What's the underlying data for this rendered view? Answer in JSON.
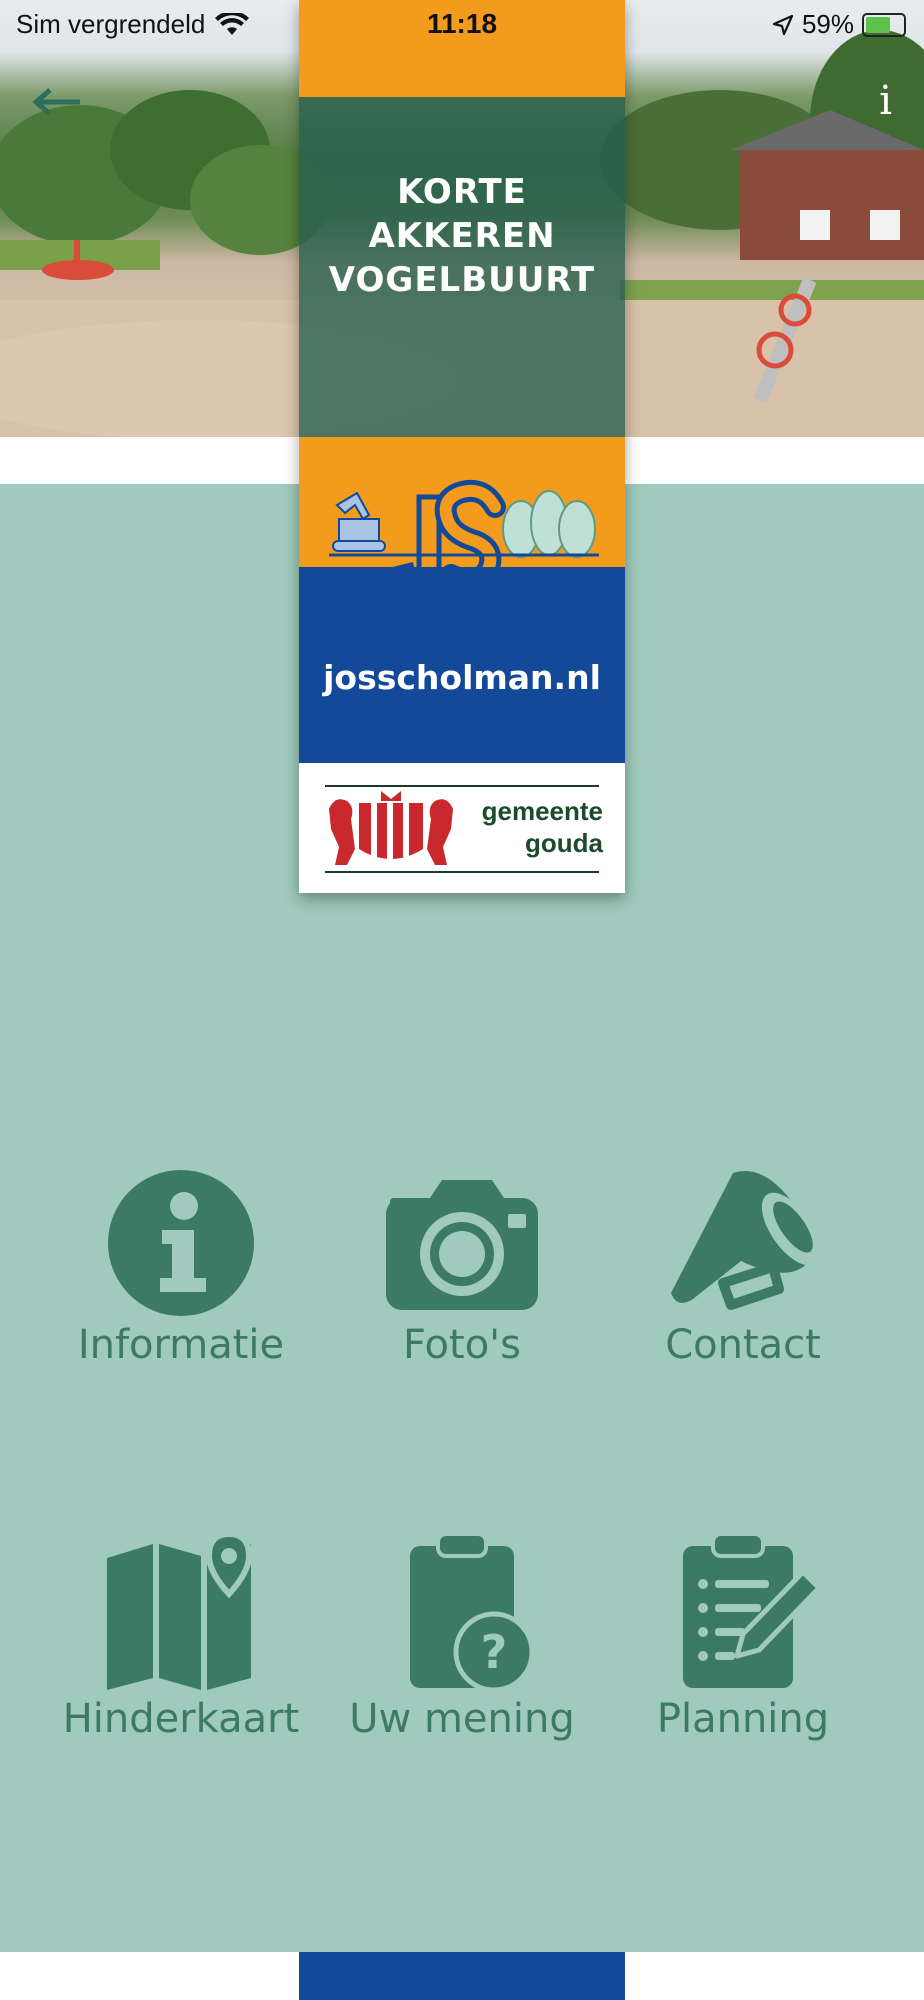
{
  "status_bar": {
    "carrier": "Sim vergrendeld",
    "time": "11:18",
    "battery": "59%",
    "battery_level": 0.59
  },
  "navigation": {
    "back_icon": "arrow-left-icon",
    "info_label": "i"
  },
  "banner": {
    "title_lines": [
      "KORTE",
      "AKKEREN",
      "VOGELBUURT"
    ],
    "website": "josscholman.nl",
    "municipality_lines": [
      "gemeente",
      "gouda"
    ],
    "colors": {
      "orange": "#f39b1d",
      "blue": "#134999",
      "green_overlay": "#245e4c"
    }
  },
  "menu": {
    "items": [
      {
        "label": "Informatie",
        "icon": "info-icon"
      },
      {
        "label": "Foto's",
        "icon": "camera-icon"
      },
      {
        "label": "Contact",
        "icon": "megaphone-icon"
      },
      {
        "label": "Hinderkaart",
        "icon": "map-pin-icon"
      },
      {
        "label": "Uw mening",
        "icon": "clipboard-question-icon"
      },
      {
        "label": "Planning",
        "icon": "clipboard-edit-icon"
      }
    ]
  },
  "colors": {
    "background_green": "#9fcabd",
    "icon_green": "#3d7a66"
  }
}
